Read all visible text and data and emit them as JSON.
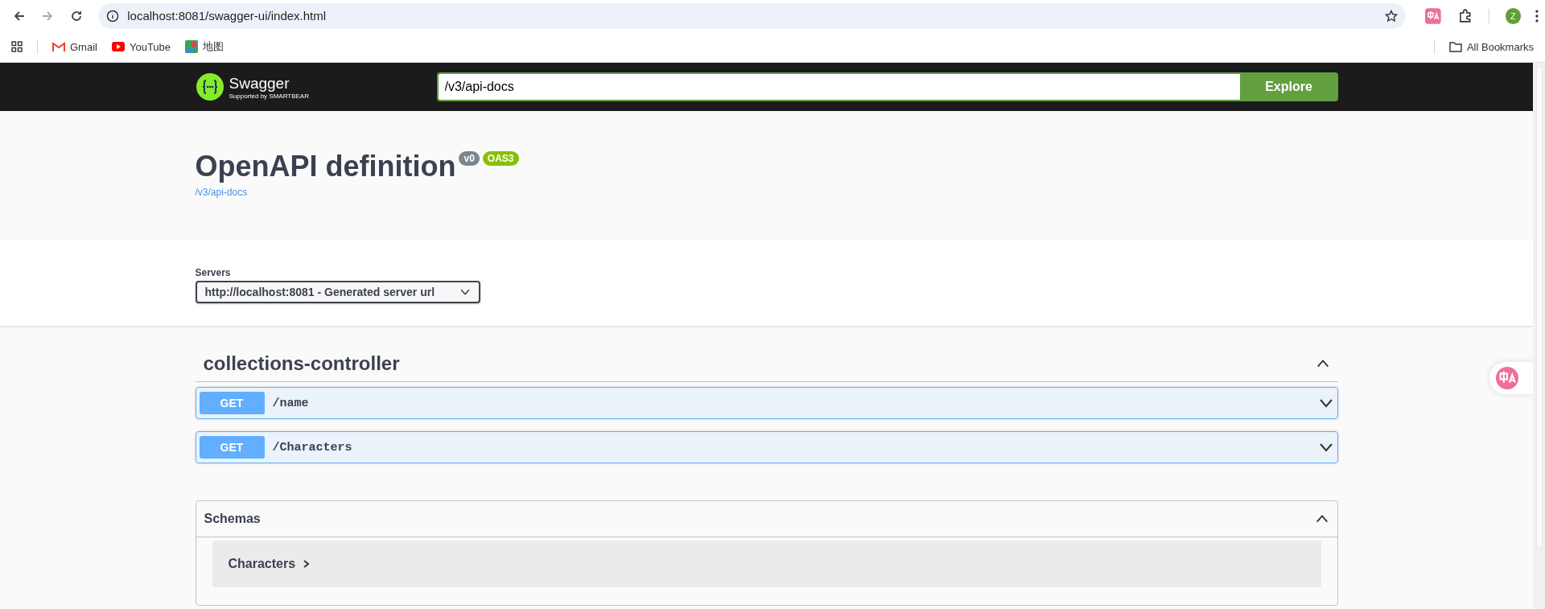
{
  "browser": {
    "url": "localhost:8081/swagger-ui/index.html",
    "profile_initial": "Z",
    "bookmarks": [
      {
        "label": "Gmail",
        "kind": "mail"
      },
      {
        "label": "YouTube",
        "kind": "video"
      },
      {
        "label": "地图",
        "kind": "map"
      }
    ],
    "all_bookmarks": "All Bookmarks"
  },
  "topbar": {
    "logo_text": "Swagger",
    "logo_sub": "Supported by SMARTBEAR",
    "url_value": "/v3/api-docs",
    "explore": "Explore"
  },
  "info": {
    "title": "OpenAPI definition",
    "version": "v0",
    "oas": "OAS3",
    "link": "/v3/api-docs"
  },
  "servers": {
    "label": "Servers",
    "value": "http://localhost:8081 - Generated server url"
  },
  "tags": [
    {
      "name": "collections-controller",
      "expanded": true,
      "operations": [
        {
          "method": "GET",
          "path": "/name",
          "expanded": false
        },
        {
          "method": "GET",
          "path": "/Characters",
          "expanded": false
        }
      ]
    }
  ],
  "schemas": {
    "title": "Schemas",
    "expanded": true,
    "models": [
      {
        "name": "Characters",
        "expanded": false
      }
    ]
  }
}
